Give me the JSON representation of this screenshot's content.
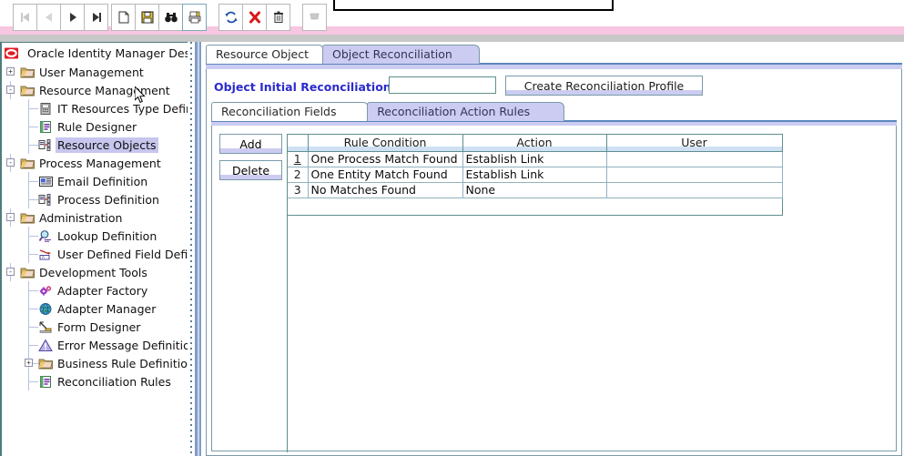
{
  "toolbar": {
    "buttons": [
      {
        "name": "first-record-button",
        "icon": "first-record-icon",
        "state": "disabled"
      },
      {
        "name": "previous-record-button",
        "icon": "previous-record-icon",
        "state": "disabled"
      },
      {
        "name": "next-record-button",
        "icon": "next-record-icon",
        "state": "enabled"
      },
      {
        "name": "last-record-button",
        "icon": "last-record-icon",
        "state": "enabled"
      },
      {
        "name": "new-button",
        "icon": "new-document-icon",
        "state": "enabled"
      },
      {
        "name": "save-button",
        "icon": "floppy-disk-icon",
        "state": "enabled"
      },
      {
        "name": "find-button",
        "icon": "binoculars-icon",
        "state": "enabled"
      },
      {
        "name": "print-button",
        "icon": "print-icon",
        "state": "selected"
      },
      {
        "name": "refresh-button",
        "icon": "refresh-arrows-icon",
        "state": "enabled"
      },
      {
        "name": "close-button",
        "icon": "red-x-icon",
        "state": "enabled"
      },
      {
        "name": "delete-button",
        "icon": "trash-can-icon",
        "state": "enabled"
      },
      {
        "name": "exit-button",
        "icon": "exit-icon",
        "state": "disabled"
      }
    ]
  },
  "sidebar": {
    "root": {
      "label": "Oracle Identity Manager Design Co",
      "icon": "oracle-logo-icon"
    },
    "items": [
      {
        "label": "User Management",
        "icon": "folder-icon",
        "depth": 0,
        "toggle": "+",
        "selected": false
      },
      {
        "label": "Resource Management",
        "icon": "folder-icon",
        "depth": 0,
        "toggle": "-",
        "selected": false
      },
      {
        "label": "IT Resources Type Definiti",
        "icon": "server-icon",
        "depth": 1,
        "toggle": "",
        "selected": false
      },
      {
        "label": "Rule Designer",
        "icon": "rule-designer-icon",
        "depth": 1,
        "toggle": "",
        "selected": false
      },
      {
        "label": "Resource Objects",
        "icon": "resource-object-icon",
        "depth": 1,
        "toggle": "",
        "selected": true
      },
      {
        "label": "Process Management",
        "icon": "folder-icon",
        "depth": 0,
        "toggle": "-",
        "selected": false
      },
      {
        "label": "Email Definition",
        "icon": "email-icon",
        "depth": 1,
        "toggle": "",
        "selected": false
      },
      {
        "label": "Process Definition",
        "icon": "process-def-icon",
        "depth": 1,
        "toggle": "",
        "selected": false
      },
      {
        "label": "Administration",
        "icon": "folder-icon",
        "depth": 0,
        "toggle": "-",
        "selected": false
      },
      {
        "label": "Lookup Definition",
        "icon": "magnifier-icon",
        "depth": 1,
        "toggle": "",
        "selected": false
      },
      {
        "label": "User Defined Field Definiti",
        "icon": "udf-icon",
        "depth": 1,
        "toggle": "",
        "selected": false
      },
      {
        "label": "Development Tools",
        "icon": "folder-icon",
        "depth": 0,
        "toggle": "-",
        "selected": false
      },
      {
        "label": "Adapter Factory",
        "icon": "gears-icon",
        "depth": 1,
        "toggle": "",
        "selected": false
      },
      {
        "label": "Adapter Manager",
        "icon": "globe-icon",
        "depth": 1,
        "toggle": "",
        "selected": false
      },
      {
        "label": "Form Designer",
        "icon": "form-designer-icon",
        "depth": 1,
        "toggle": "",
        "selected": false
      },
      {
        "label": "Error Message Definition",
        "icon": "warning-triangle-icon",
        "depth": 1,
        "toggle": "",
        "selected": false
      },
      {
        "label": "Business Rule Definition",
        "icon": "folder-icon",
        "depth": 1,
        "toggle": "+",
        "selected": false
      },
      {
        "label": "Reconciliation Rules",
        "icon": "rule-designer-icon",
        "depth": 1,
        "toggle": "",
        "selected": false
      }
    ]
  },
  "main": {
    "outer_tabs": [
      {
        "label": "Resource Object",
        "active": false
      },
      {
        "label": "Object Reconciliation",
        "active": true
      }
    ],
    "field": {
      "label": "Object Initial Reconciliation Date",
      "value": "",
      "placeholder": ""
    },
    "create_profile_button": {
      "mnemonic": "C",
      "rest": "reate Reconciliation Profile"
    },
    "inner_tabs": [
      {
        "label": "Reconciliation Fields",
        "active": false
      },
      {
        "label": "Reconciliation Action Rules",
        "active": true
      }
    ],
    "side_buttons": [
      {
        "name": "add-button",
        "mnemonic": "A",
        "rest": "dd"
      },
      {
        "name": "delete-button",
        "mnemonic": "D",
        "rest": "elete"
      }
    ],
    "table": {
      "columns": [
        "",
        "Rule Condition",
        "Action",
        "User"
      ],
      "rows": [
        {
          "num": "1",
          "selected": true,
          "rule_condition": "One Process Match Found",
          "action": "Establish Link",
          "user": ""
        },
        {
          "num": "2",
          "selected": false,
          "rule_condition": "One Entity Match Found",
          "action": "Establish Link",
          "user": ""
        },
        {
          "num": "3",
          "selected": false,
          "rule_condition": "No Matches Found",
          "action": "None",
          "user": ""
        }
      ]
    }
  },
  "colors": {
    "accent_tab": "#ccccf2",
    "label_blue": "#2b2bcc",
    "border_teal": "#5f8f8f",
    "header_blue": "#cfe0f5",
    "selection": "#c6c6ee",
    "pink_strip": "#f7c6e0"
  }
}
